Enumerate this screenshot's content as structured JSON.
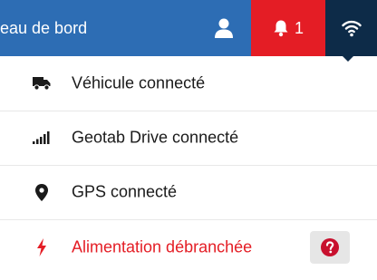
{
  "header": {
    "title": "eau de bord",
    "notification_count": "1",
    "colors": {
      "bar": "#2d6db4",
      "alert": "#e41d25",
      "wifi": "#0d2b48"
    },
    "icons": [
      "user-icon",
      "bell-icon",
      "wifi-icon"
    ]
  },
  "status_menu": {
    "items": [
      {
        "icon": "truck-icon",
        "label": "Véhicule connecté"
      },
      {
        "icon": "signal-bars-icon",
        "label": "Geotab Drive connecté"
      },
      {
        "icon": "map-pin-icon",
        "label": "GPS connecté"
      },
      {
        "icon": "lightning-icon",
        "label": "Alimentation débranchée",
        "help_icon": "help-icon"
      }
    ]
  }
}
